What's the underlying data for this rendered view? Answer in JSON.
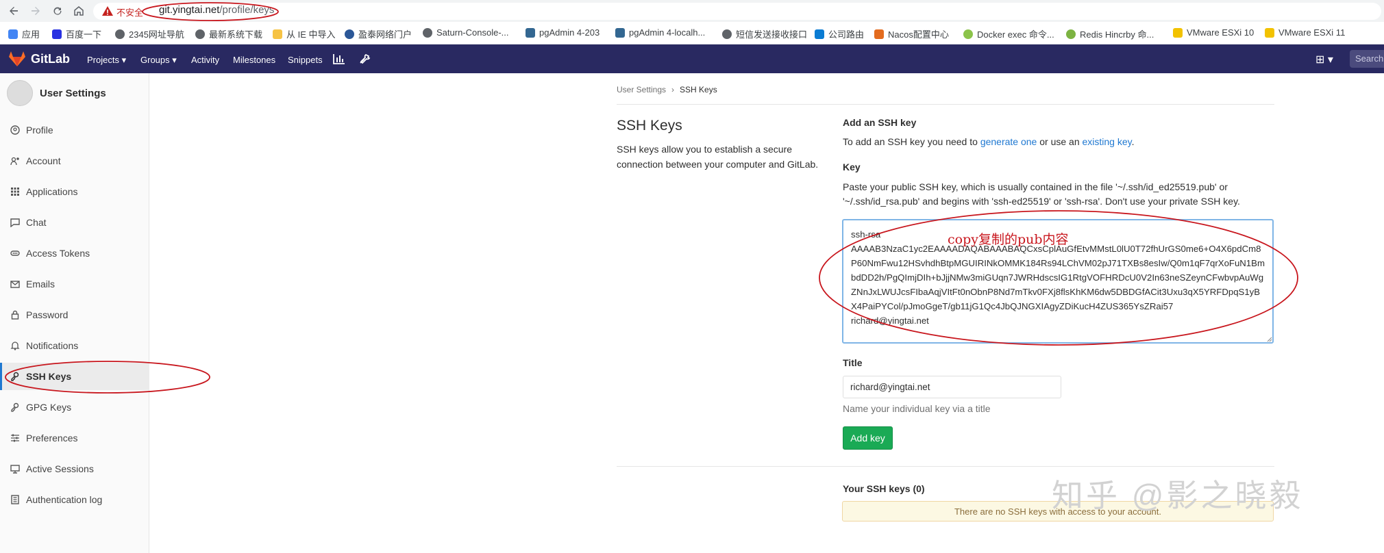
{
  "browser": {
    "insecure_label": "不安全",
    "url_host": "git.yingtai.net",
    "url_path": "/profile/keys",
    "bookmarks": [
      {
        "label": "应用",
        "color": "#4285f4",
        "icon": "apps-grid-icon"
      },
      {
        "label": "百度一下",
        "color": "#2932e1",
        "icon": "baidu-icon"
      },
      {
        "label": "2345网址导航",
        "color": "#5f6368",
        "icon": "globe-icon"
      },
      {
        "label": "最新系统下载",
        "color": "#5f6368",
        "icon": "globe-icon"
      },
      {
        "label": "从 IE 中导入",
        "color": "#f6c344",
        "icon": "folder-icon"
      },
      {
        "label": "盈泰网络门户",
        "color": "#2b5797",
        "icon": "shield-icon"
      },
      {
        "label": "Saturn-Console-...",
        "color": "#5f6368",
        "icon": "globe-icon"
      },
      {
        "label": "pgAdmin 4-203",
        "color": "#336791",
        "icon": "pgadmin-icon"
      },
      {
        "label": "pgAdmin 4-localh...",
        "color": "#336791",
        "icon": "pgadmin-icon"
      },
      {
        "label": "短信发送接收接口",
        "color": "#5f6368",
        "icon": "globe-icon"
      },
      {
        "label": "公司路由",
        "color": "#0a7cd3",
        "icon": "tp-link-icon"
      },
      {
        "label": "Nacos配置中心",
        "color": "#e36b1e",
        "icon": "nacos-icon"
      },
      {
        "label": "Docker exec 命令...",
        "color": "#8bc34a",
        "icon": "docker-icon"
      },
      {
        "label": "Redis Hincrby 命...",
        "color": "#7cb342",
        "icon": "redis-icon"
      },
      {
        "label": "VMware ESXi 10",
        "color": "#f2c200",
        "icon": "vmware-icon"
      },
      {
        "label": "VMware ESXi 11",
        "color": "#f2c200",
        "icon": "vmware-icon"
      }
    ]
  },
  "header": {
    "brand": "GitLab",
    "nav": [
      "Projects",
      "Groups",
      "Activity",
      "Milestones",
      "Snippets"
    ],
    "search_placeholder": "Search",
    "brand_color": "#292961"
  },
  "sidebar": {
    "title": "User Settings",
    "items": [
      {
        "label": "Profile",
        "icon": "profile-icon"
      },
      {
        "label": "Account",
        "icon": "account-icon"
      },
      {
        "label": "Applications",
        "icon": "applications-icon"
      },
      {
        "label": "Chat",
        "icon": "chat-icon"
      },
      {
        "label": "Access Tokens",
        "icon": "access-tokens-icon"
      },
      {
        "label": "Emails",
        "icon": "email-icon"
      },
      {
        "label": "Password",
        "icon": "lock-icon"
      },
      {
        "label": "Notifications",
        "icon": "bell-icon"
      },
      {
        "label": "SSH Keys",
        "icon": "key-icon",
        "active": true
      },
      {
        "label": "GPG Keys",
        "icon": "key-icon"
      },
      {
        "label": "Preferences",
        "icon": "preferences-icon"
      },
      {
        "label": "Active Sessions",
        "icon": "sessions-icon"
      },
      {
        "label": "Authentication log",
        "icon": "log-icon"
      }
    ]
  },
  "breadcrumb": {
    "parent": "User Settings",
    "current": "SSH Keys"
  },
  "intro": {
    "title": "SSH Keys",
    "description": "SSH keys allow you to establish a secure connection between your computer and GitLab."
  },
  "add_key": {
    "title": "Add an SSH key",
    "text_before": "To add an SSH key you need to ",
    "generate_link": "generate one",
    "text_middle": " or use an ",
    "existing_link": "existing key",
    "text_after": ".",
    "key_label": "Key",
    "key_help": "Paste your public SSH key, which is usually contained in the file '~/.ssh/id_ed25519.pub' or '~/.ssh/id_rsa.pub' and begins with 'ssh-ed25519' or 'ssh-rsa'. Don't use your private SSH key.",
    "key_value": "ssh-rsa\nAAAAB3NzaC1yc2EAAAADAQABAAABAQCxsCplAuGfEtvMMstL0lU0T72fhUrGS0me6+O4X6pdCm8P60NmFwu12HSvhdhBtpMGUIRINkOMMK184Rs94LChVM02pJ71TXBs8esIw/Q0m1qF7qrXoFuN1BmbdDD2h/PgQImjDIh+bJjjNMw3miGUqn7JWRHdscsIG1RtgVOFHRDcU0V2In63neSZeynCFwbvpAuWgZNnJxLWUJcsFIbaAqjVItFt0nObnP8Nd7mTkv0FXj8flsKhKM6dw5DBDGfACit3Uxu3qX5YRFDpqS1yBX4PaiPYCol/pJmoGgeT/gb11jG1Qc4JbQJNGXIAgyZDiKucH4ZUS365YsZRai57\nrichard@yingtai.net",
    "title_label": "Title",
    "title_value": "richard@yingtai.net",
    "title_hint": "Name your individual key via a title",
    "add_button": "Add key"
  },
  "your_keys": {
    "title": "Your SSH keys (0)",
    "empty": "There are no SSH keys with access to your account."
  },
  "annotations": {
    "note": "copy复制的pub内容",
    "watermark": "知乎 @影之晓毅",
    "color": "#c8161d"
  }
}
